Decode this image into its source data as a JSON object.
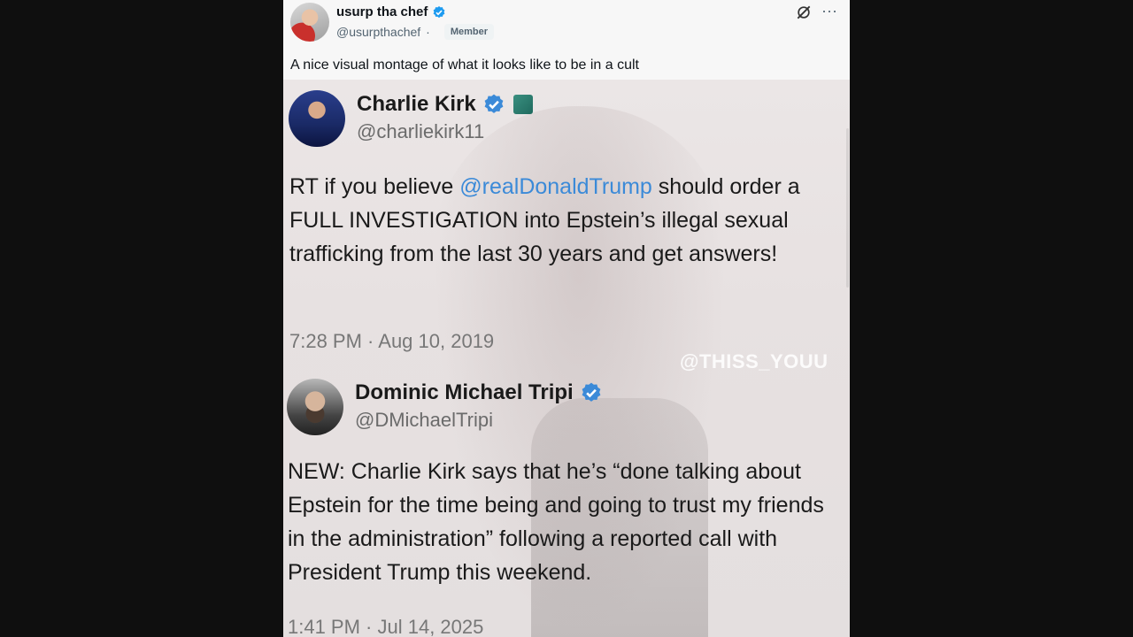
{
  "post": {
    "author_name": "usurp tha chef",
    "author_handle": "@usurpthachef",
    "separator": "·",
    "badge": "Member",
    "text": "A nice visual montage of what it looks like to be in a cult",
    "icons": [
      "verified-badge-icon",
      "grok-icon",
      "more-options-icon"
    ],
    "more_glyph": "···"
  },
  "video": {
    "watermark": "@THISS_YOUU",
    "embedded_tweets": [
      {
        "name": "Charlie Kirk",
        "handle": "@charliekirk11",
        "body_pre": "RT if you believe ",
        "mention": "@realDonaldTrump",
        "body_post": " should order a FULL INVESTIGATION into Epstein’s illegal sexual trafficking from the last 30 years and get answers!",
        "time": "7:28 PM · Aug 10, 2019"
      },
      {
        "name": "Dominic Michael Tripi",
        "handle": "@DMichaelTripi",
        "body": "NEW: Charlie Kirk says that he’s “done talking about Epstein for the time being and going to trust my friends in the administration” following a reported call with President Trump this weekend.",
        "time": "1:41 PM · Jul 14, 2025"
      }
    ]
  },
  "colors": {
    "verified_blue": "#1d9bf0",
    "mention_blue": "#3b8ad8",
    "page_background": "#0f0f0f"
  }
}
